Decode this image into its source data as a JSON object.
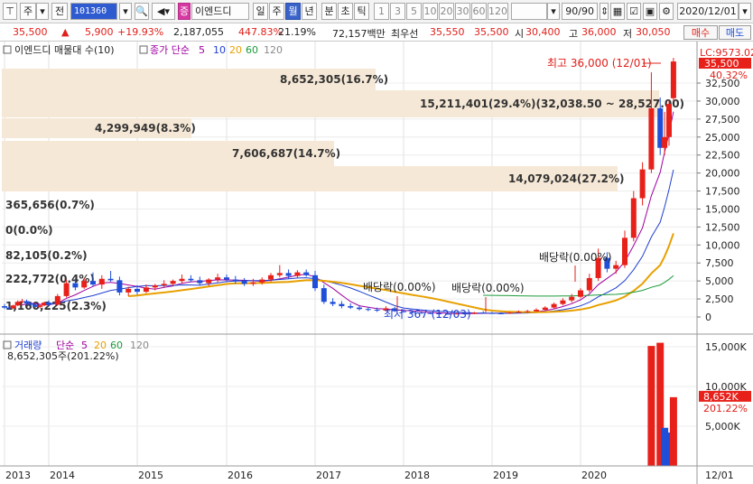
{
  "toolbar": {
    "market": "주",
    "prev": "전",
    "code": "101360",
    "stock_name": "이엔드디",
    "badge": "증",
    "periods": [
      "일",
      "주",
      "월",
      "년",
      "분",
      "초",
      "틱"
    ],
    "active_period": "월",
    "numbers": [
      "1",
      "3",
      "5",
      "10",
      "20",
      "30",
      "60",
      "120"
    ],
    "count": "90/90",
    "date": "2020/12/01"
  },
  "quote": {
    "price": "35,500",
    "change": "5,900",
    "change_pct": "+19.93%",
    "volume": "2,187,055",
    "volume_ratio": "447.83%",
    "turnover": "21.19%",
    "amount": "72,157백만",
    "best_label": "최우선",
    "ask": "35,550",
    "bid": "35,500",
    "open_label": "시",
    "open": "30,400",
    "high_label": "고",
    "high": "36,000",
    "low_label": "저",
    "low": "30,050",
    "buy_label": "매수",
    "sell_label": "매도"
  },
  "legend": {
    "title": "이엔드디 매물대 수(10)",
    "ma_label": "종가 단순",
    "ma_periods": [
      "5",
      "10",
      "20",
      "60",
      "120"
    ],
    "ma_colors": [
      "#a000a0",
      "#1f3fd0",
      "#e8a000",
      "#1a9a3a",
      "#8a8a8a"
    ]
  },
  "price_axis": {
    "ticks": [
      "32,500",
      "30,000",
      "27,500",
      "25,000",
      "22,500",
      "20,000",
      "17,500",
      "15,000",
      "12,500",
      "10,000",
      "7,500",
      "5,000",
      "2,500",
      "0"
    ],
    "lc": "LC:9573.02",
    "current": "35,500",
    "pct": "40.32%"
  },
  "volume_profile": [
    {
      "label": "8,652,305(16.7%)"
    },
    {
      "label": "15,211,401(29.4%)(32,038.50 ~ 28,527.00)"
    },
    {
      "label": "4,299,949(8.3%)"
    },
    {
      "label": "7,606,687(14.7%)"
    },
    {
      "label": "14,079,024(27.2%)"
    },
    {
      "label": "365,656(0.7%)"
    },
    {
      "label": "0(0.0%)"
    },
    {
      "label": "82,105(0.2%)"
    },
    {
      "label": "222,772(0.4%)"
    },
    {
      "label": "1,160,225(2.3%)"
    }
  ],
  "annotations": {
    "high": "최고 36,000 (12/01)",
    "low": "최저 367 (12/03)",
    "dividend1": "배당락(0.00%)",
    "dividend2": "배당락(0.00%)",
    "dividend3": "배당락(0.00%)"
  },
  "volume_panel": {
    "label": "거래량",
    "ma_label": "단순",
    "ma_periods": [
      "5",
      "20",
      "60",
      "120"
    ],
    "current": "8,652,305주(201.22%)",
    "axis": [
      "15,000K",
      "10,000K",
      "5,000K"
    ],
    "tag": "8,652K",
    "tag_pct": "201.22%"
  },
  "x_axis": {
    "years": [
      "2013",
      "2014",
      "2015",
      "2016",
      "2017",
      "2018",
      "2019",
      "2020"
    ],
    "end_label": "12/01"
  },
  "colors": {
    "up": "#e8201a",
    "down": "#1f4fd8",
    "profile": "#f6e8d6",
    "accent": "#3a63c9"
  },
  "chart_data": {
    "type": "candlestick",
    "interval": "monthly",
    "ylim": [
      0,
      36000
    ],
    "series": [
      {
        "name": "price",
        "values": [
          [
            2013.0,
            1500,
            1800,
            1100,
            1300
          ],
          [
            2013.1,
            1300,
            1500,
            1000,
            1200
          ],
          [
            2013.2,
            1200,
            1700,
            1100,
            1600
          ],
          [
            2013.3,
            1600,
            2300,
            1500,
            2100
          ],
          [
            2013.4,
            2100,
            2500,
            1900,
            2200
          ],
          [
            2013.5,
            2200,
            2400,
            1700,
            1900
          ],
          [
            2013.6,
            1900,
            2100,
            1500,
            1700
          ],
          [
            2013.7,
            1700,
            1900,
            1300,
            1400
          ],
          [
            2013.8,
            1400,
            1700,
            1200,
            1600
          ],
          [
            2013.9,
            1600,
            2100,
            1500,
            2000
          ],
          [
            2014.0,
            2000,
            2300,
            1500,
            1700
          ],
          [
            2014.1,
            1700,
            3200,
            1600,
            2900
          ],
          [
            2014.2,
            2900,
            5200,
            2700,
            4700
          ],
          [
            2014.3,
            4700,
            5300,
            3700,
            4100
          ],
          [
            2014.4,
            4100,
            5400,
            3900,
            5000
          ],
          [
            2014.5,
            5000,
            6200,
            4200,
            4500
          ],
          [
            2014.6,
            4500,
            5800,
            3900,
            5300
          ],
          [
            2014.7,
            5300,
            6400,
            4900,
            5100
          ],
          [
            2014.8,
            5100,
            5600,
            3000,
            3400
          ],
          [
            2014.9,
            3400,
            4200,
            2900,
            3900
          ],
          [
            2015.0,
            3900,
            4400,
            3100,
            3500
          ],
          [
            2015.1,
            3500,
            4500,
            3300,
            4100
          ],
          [
            2015.2,
            4100,
            4600,
            3700,
            4400
          ],
          [
            2015.3,
            4400,
            5100,
            4100,
            4600
          ],
          [
            2015.4,
            4600,
            5200,
            4300,
            5000
          ],
          [
            2015.5,
            5000,
            5900,
            4600,
            5300
          ],
          [
            2015.6,
            5300,
            5800,
            4900,
            5100
          ],
          [
            2015.7,
            5100,
            5600,
            4400,
            4700
          ],
          [
            2015.8,
            4700,
            5400,
            4300,
            5200
          ],
          [
            2015.9,
            5200,
            6000,
            4800,
            5500
          ],
          [
            2016.0,
            5500,
            5900,
            4900,
            5200
          ],
          [
            2016.1,
            5200,
            5700,
            4600,
            5000
          ],
          [
            2016.2,
            5000,
            5400,
            4300,
            4600
          ],
          [
            2016.3,
            4600,
            5300,
            4300,
            4800
          ],
          [
            2016.4,
            4800,
            5500,
            4500,
            5200
          ],
          [
            2016.5,
            5200,
            6100,
            4900,
            5800
          ],
          [
            2016.6,
            5800,
            7200,
            5500,
            6100
          ],
          [
            2016.7,
            6100,
            6600,
            5300,
            5700
          ],
          [
            2016.8,
            5700,
            6500,
            5400,
            6200
          ],
          [
            2016.9,
            6200,
            6600,
            5600,
            5800
          ],
          [
            2017.0,
            5800,
            6400,
            3600,
            4000
          ],
          [
            2017.1,
            4000,
            4500,
            1800,
            2100
          ],
          [
            2017.2,
            2100,
            2600,
            1500,
            1800
          ],
          [
            2017.3,
            1800,
            2200,
            1200,
            1500
          ],
          [
            2017.4,
            1500,
            1900,
            1100,
            1300
          ],
          [
            2017.5,
            1300,
            1600,
            900,
            1100
          ],
          [
            2017.6,
            1100,
            1400,
            800,
            1000
          ],
          [
            2017.7,
            1000,
            1300,
            700,
            900
          ],
          [
            2017.8,
            900,
            1500,
            800,
            1200
          ],
          [
            2017.9,
            1200,
            1400,
            700,
            800
          ],
          [
            2018.0,
            800,
            1100,
            600,
            700
          ],
          [
            2018.1,
            700,
            900,
            500,
            600
          ],
          [
            2018.2,
            600,
            800,
            450,
            550
          ],
          [
            2018.3,
            550,
            700,
            400,
            500
          ],
          [
            2018.4,
            500,
            650,
            380,
            450
          ],
          [
            2018.5,
            450,
            600,
            367,
            420
          ],
          [
            2018.6,
            420,
            550,
            380,
            480
          ],
          [
            2018.7,
            480,
            600,
            400,
            450
          ],
          [
            2018.8,
            450,
            700,
            420,
            600
          ],
          [
            2018.9,
            600,
            800,
            500,
            550
          ],
          [
            2019.0,
            550,
            700,
            450,
            500
          ],
          [
            2019.1,
            500,
            650,
            420,
            480
          ],
          [
            2019.2,
            480,
            700,
            450,
            600
          ],
          [
            2019.3,
            600,
            900,
            550,
            700
          ],
          [
            2019.4,
            700,
            1000,
            600,
            800
          ],
          [
            2019.5,
            800,
            1200,
            700,
            1000
          ],
          [
            2019.6,
            1000,
            1500,
            900,
            1300
          ],
          [
            2019.7,
            1300,
            2000,
            1100,
            1800
          ],
          [
            2019.8,
            1800,
            2600,
            1600,
            2300
          ],
          [
            2019.9,
            2300,
            3200,
            2000,
            2800
          ],
          [
            2020.0,
            2800,
            4000,
            2600,
            3700
          ],
          [
            2020.1,
            3700,
            6000,
            3400,
            5400
          ],
          [
            2020.2,
            5400,
            9500,
            5000,
            8200
          ],
          [
            2020.3,
            8200,
            9000,
            6200,
            6700
          ],
          [
            2020.4,
            6700,
            7800,
            6000,
            7200
          ],
          [
            2020.5,
            7200,
            12000,
            6800,
            11000
          ],
          [
            2020.6,
            11000,
            17500,
            10500,
            16500
          ],
          [
            2020.7,
            16500,
            21500,
            15500,
            20500
          ],
          [
            2020.8,
            20500,
            34000,
            20000,
            29000
          ],
          [
            2020.9,
            29000,
            30500,
            22500,
            23500
          ],
          [
            2020.95,
            23500,
            28500,
            22500,
            25000
          ],
          [
            2021.0,
            25000,
            30000,
            23800,
            29600
          ],
          [
            2021.05,
            30400,
            36000,
            30050,
            35500
          ]
        ]
      },
      {
        "name": "volume",
        "values": [
          [
            2020.8,
            15100
          ],
          [
            2020.9,
            15500
          ],
          [
            2020.95,
            4800
          ],
          [
            2021.0,
            4200
          ],
          [
            2021.05,
            8652
          ]
        ]
      }
    ],
    "ylabel": ""
  }
}
